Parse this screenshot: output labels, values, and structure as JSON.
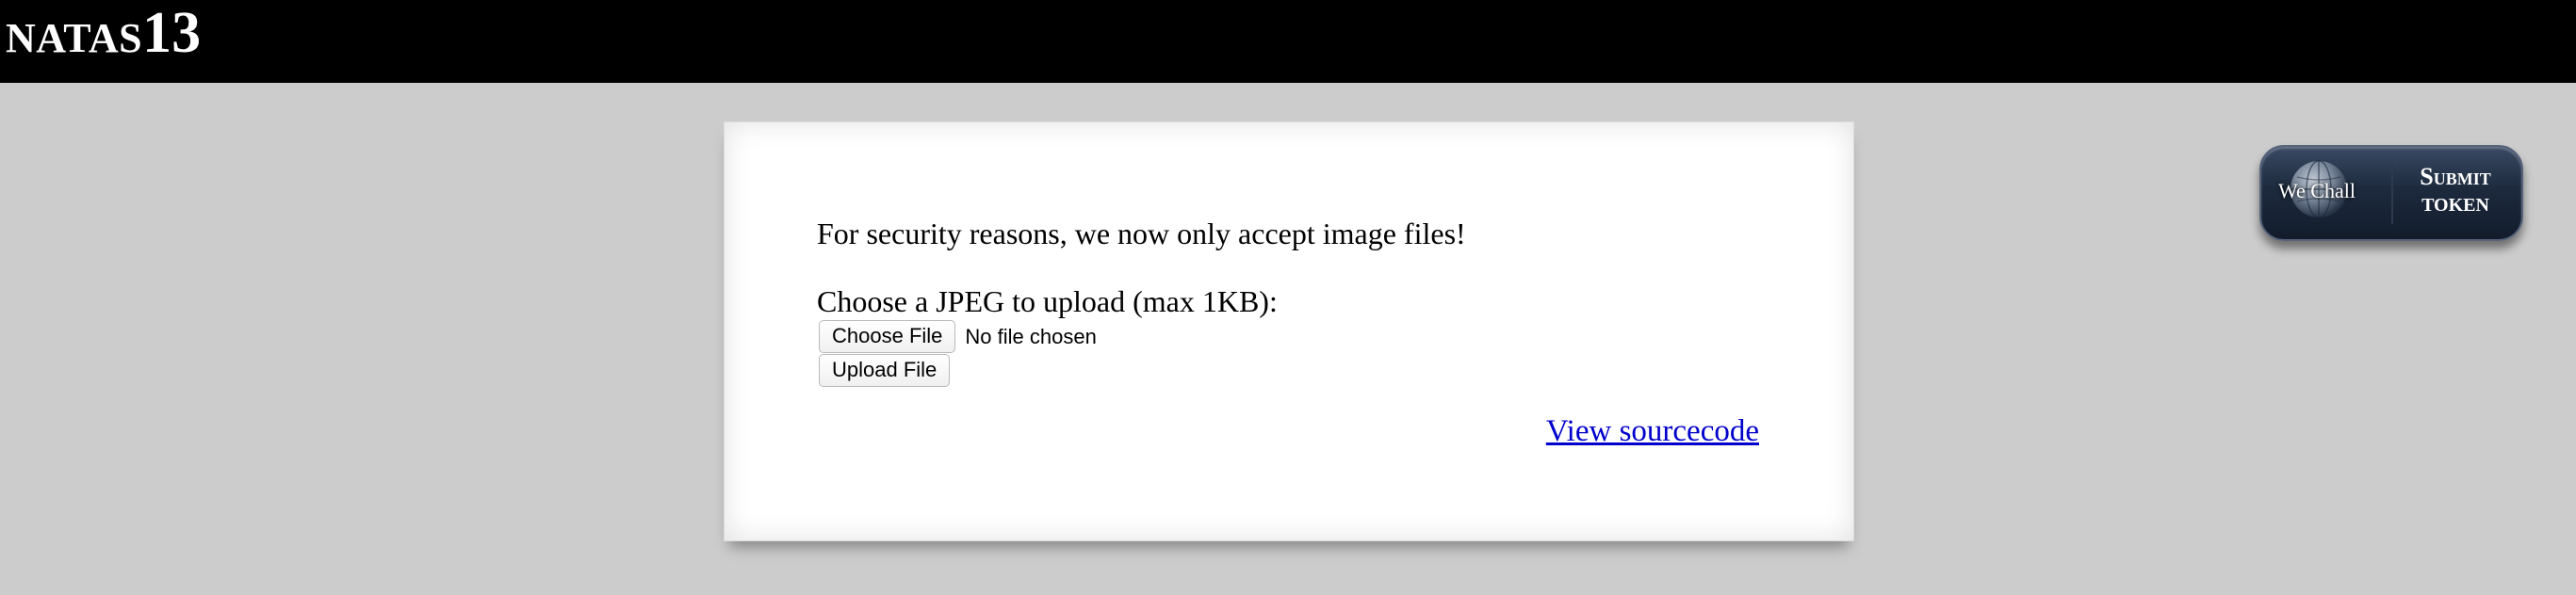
{
  "header": {
    "logo_prefix": "NATAS",
    "logo_number": "13"
  },
  "content": {
    "notice": "For security reasons, we now only accept image files!",
    "upload_prompt": "Choose a JPEG to upload (max 1KB):",
    "choose_file_label": "Choose File",
    "no_file_text": "No file chosen",
    "upload_button_label": "Upload File",
    "view_source_link": "View sourcecode"
  },
  "wechall": {
    "name": "We Chall",
    "submit_label": "Submit",
    "token_label": "TOKEN"
  },
  "colors": {
    "header_bg": "#000000",
    "page_bg": "#cccccc",
    "card_bg": "#ffffff",
    "link": "#0000cc",
    "badge_bg": "#1d2a3e"
  },
  "icons": [
    "globe-icon"
  ]
}
